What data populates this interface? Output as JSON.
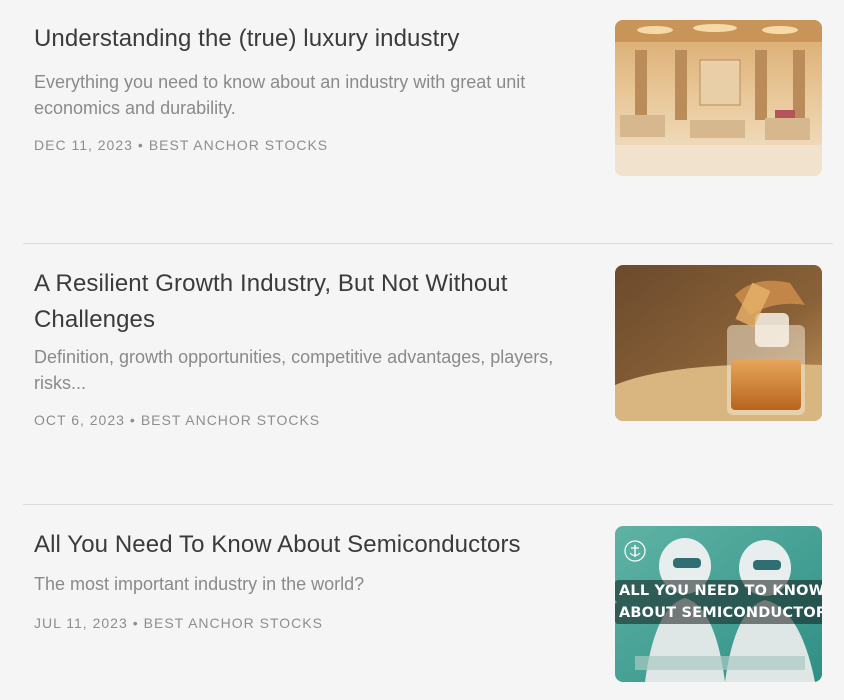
{
  "posts": [
    {
      "title": "Understanding the (true) luxury industry",
      "subtitle": "Everything you need to know about an industry with great unit economics and durability.",
      "date": "DEC 11, 2023",
      "separator": "•",
      "author": "BEST ANCHOR STOCKS",
      "thumbnail_icon": "luxury-store-image"
    },
    {
      "title": "A Resilient Growth Industry, But Not Without Challenges",
      "subtitle": "Definition, growth opportunities, competitive advantages, players, risks...",
      "date": "OCT 6, 2023",
      "separator": "•",
      "author": "BEST ANCHOR STOCKS",
      "thumbnail_icon": "whiskey-glass-image"
    },
    {
      "title": "All You Need To Know About Semiconductors",
      "subtitle": "The most important industry in the world?",
      "date": "JUL 11, 2023",
      "separator": "•",
      "author": "BEST ANCHOR STOCKS",
      "thumbnail_icon": "semiconductor-workers-image",
      "thumbnail_caption_line1": "ALL YOU NEED TO KNOW",
      "thumbnail_caption_line2": "ABOUT SEMICONDUCTORS"
    }
  ],
  "colors": {
    "background": "#f5f5f5",
    "title": "#3b3b3b",
    "subtitle": "#8a8a8a",
    "meta": "#8e8e8e",
    "divider": "#dcdcdc"
  }
}
